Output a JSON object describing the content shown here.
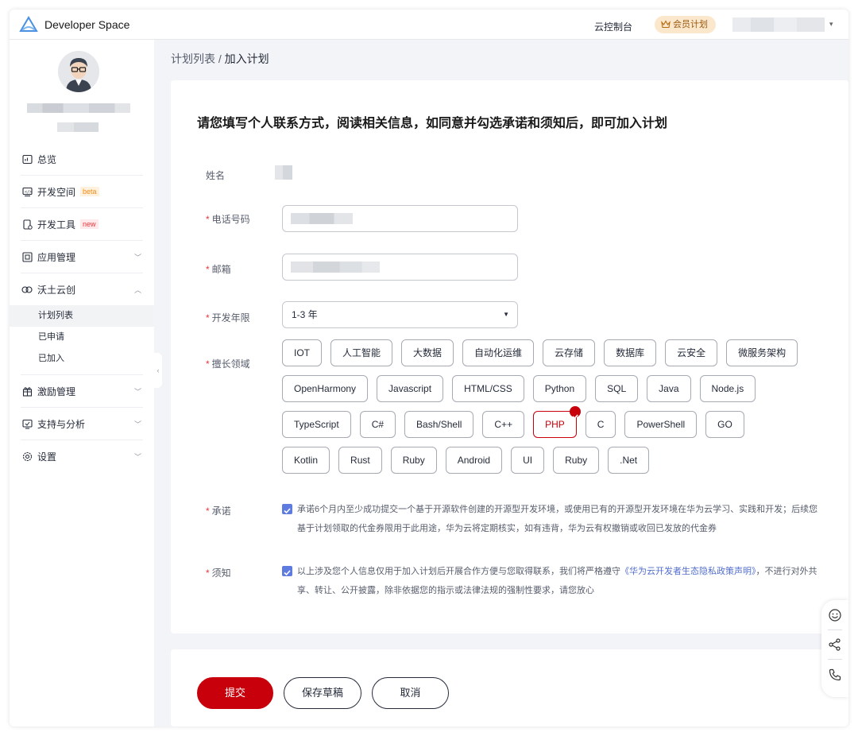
{
  "header": {
    "brand": "Developer Space",
    "console_label": "云控制台",
    "vip_label": "会员计划",
    "user_caret": "▾"
  },
  "sidebar": {
    "items": [
      {
        "label": "总览"
      },
      {
        "label": "开发空间",
        "badge": "beta"
      },
      {
        "label": "开发工具",
        "badge": "new"
      },
      {
        "label": "应用管理",
        "chevron": "﹀"
      },
      {
        "label": "沃土云创",
        "chevron": "︿"
      },
      {
        "label": "激励管理",
        "chevron": "﹀"
      },
      {
        "label": "支持与分析",
        "chevron": "﹀"
      },
      {
        "label": "设置",
        "chevron": "﹀"
      }
    ],
    "sub_items": [
      {
        "label": "计划列表",
        "active": true
      },
      {
        "label": "已申请"
      },
      {
        "label": "已加入"
      }
    ],
    "collapse_glyph": "‹"
  },
  "breadcrumb": {
    "parent": "计划列表",
    "separator": " / ",
    "current": "加入计划"
  },
  "form": {
    "title": "请您填写个人联系方式，阅读相关信息，如同意并勾选承诺和须知后，即可加入计划",
    "name_label": "姓名",
    "required_mark": "*",
    "phone_label": "电话号码",
    "email_label": "邮箱",
    "years_label": "开发年限",
    "years_value": "1-3 年",
    "years_caret": "▼",
    "domain_label": "擅长领域",
    "tags": [
      [
        "IOT",
        "人工智能",
        "大数据",
        "自动化运维",
        "云存储",
        "数据库",
        "云安全",
        "微服务架构"
      ],
      [
        "OpenHarmony",
        "Javascript",
        "HTML/CSS",
        "Python",
        "SQL",
        "Java",
        "Node.js"
      ],
      [
        "TypeScript",
        "C#",
        "Bash/Shell",
        "C++",
        "PHP",
        "C",
        "PowerShell",
        "GO"
      ],
      [
        "Kotlin",
        "Rust",
        "Ruby",
        "Android",
        "UI",
        "Ruby",
        ".Net"
      ]
    ],
    "selected_tag": "PHP",
    "promise_label": "承诺",
    "promise_text": "承诺6个月内至少成功提交一个基于开源软件创建的开源型开发环境，或使用已有的开源型开发环境在华为云学习、实践和开发；后续您基于计划领取的代金券限用于此用途，华为云将定期核实，如有违背，华为云有权撤销或收回已发放的代金券",
    "notice_label": "须知",
    "notice_text_before": "以上涉及您个人信息仅用于加入计划后开展合作方便与您取得联系，我们将严格遵守",
    "notice_link": "《华为云开发者生态隐私政策声明》",
    "notice_text_after": "，不进行对外共享、转让、公开披露，除非依据您的指示或法律法规的强制性要求，请您放心"
  },
  "actions": {
    "submit_label": "提交",
    "save_label": "保存草稿",
    "cancel_label": "取消"
  },
  "colors": {
    "brand_red": "#c7000b",
    "checkbox_blue": "#5e7ce0",
    "link_blue": "#526ecc",
    "vip_bg": "#fbe7cc"
  },
  "icons": [
    "logo-icon",
    "crown-icon",
    "overview-icon",
    "devspace-icon",
    "devtools-icon",
    "app-manage-icon",
    "cloud-create-icon",
    "gift-icon",
    "support-icon",
    "settings-icon",
    "smile-icon",
    "share-icon",
    "phone-icon"
  ]
}
